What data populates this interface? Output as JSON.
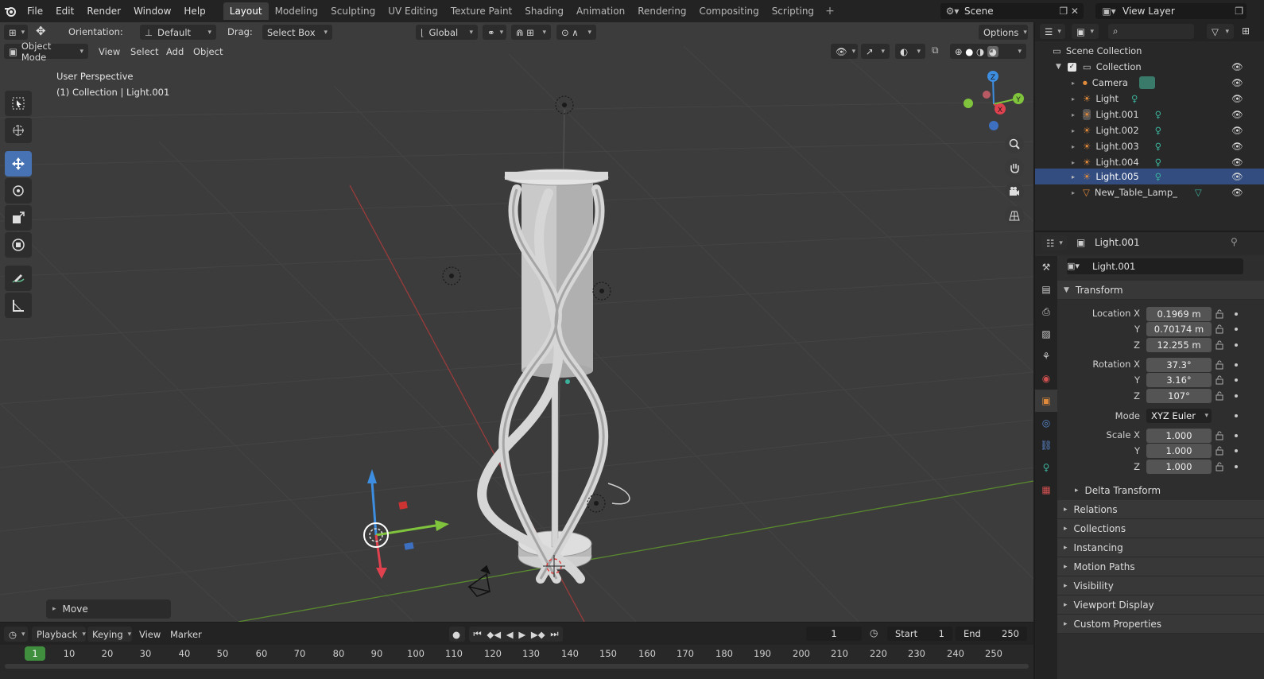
{
  "menu": {
    "items": [
      "File",
      "Edit",
      "Render",
      "Window",
      "Help"
    ]
  },
  "workspaces": {
    "tabs": [
      "Layout",
      "Modeling",
      "Sculpting",
      "UV Editing",
      "Texture Paint",
      "Shading",
      "Animation",
      "Rendering",
      "Compositing",
      "Scripting"
    ],
    "active": "Layout"
  },
  "scene": {
    "name": "Scene",
    "view_layer": "View Layer"
  },
  "viewport_header": {
    "orientation_label": "Orientation:",
    "orientation_value": "Default",
    "drag_label": "Drag:",
    "drag_value": "Select Box",
    "transform_orientation": "Global",
    "options_label": "Options",
    "mode": "Object Mode",
    "menus": [
      "View",
      "Select",
      "Add",
      "Object"
    ]
  },
  "viewport_info": {
    "perspective": "User Perspective",
    "context": "(1) Collection | Light.001"
  },
  "gizmo": {
    "x": "X",
    "y": "Y",
    "z": "Z"
  },
  "operator_panel": {
    "label": "Move"
  },
  "timeline": {
    "menus": [
      "Playback",
      "Keying",
      "View",
      "Marker"
    ],
    "current_frame": "1",
    "start_label": "Start",
    "start_value": "1",
    "end_label": "End",
    "end_value": "250",
    "ruler": [
      "1",
      "10",
      "20",
      "30",
      "40",
      "50",
      "60",
      "70",
      "80",
      "90",
      "100",
      "110",
      "120",
      "130",
      "140",
      "150",
      "160",
      "170",
      "180",
      "190",
      "200",
      "210",
      "220",
      "230",
      "240",
      "250"
    ]
  },
  "outliner": {
    "root": "Scene Collection",
    "collection": "Collection",
    "items": [
      {
        "name": "Camera",
        "type": "camera"
      },
      {
        "name": "Light",
        "type": "light"
      },
      {
        "name": "Light.001",
        "type": "light"
      },
      {
        "name": "Light.002",
        "type": "light"
      },
      {
        "name": "Light.003",
        "type": "light"
      },
      {
        "name": "Light.004",
        "type": "light"
      },
      {
        "name": "Light.005",
        "type": "light",
        "selected": true
      },
      {
        "name": "New_Table_Lamp_",
        "type": "mesh"
      }
    ]
  },
  "properties": {
    "header_object": "Light.001",
    "object_name": "Light.001",
    "transform": {
      "title": "Transform",
      "location_label": "Location X",
      "location": [
        "0.1969 m",
        "0.70174 m",
        "12.255 m"
      ],
      "rotation_label": "Rotation X",
      "rotation": [
        "37.3°",
        "3.16°",
        "107°"
      ],
      "mode_label": "Mode",
      "mode_value": "XYZ Euler",
      "scale_label": "Scale X",
      "scale": [
        "1.000",
        "1.000",
        "1.000"
      ],
      "axis_y": "Y",
      "axis_z": "Z"
    },
    "delta_transform": "Delta Transform",
    "panels": [
      "Relations",
      "Collections",
      "Instancing",
      "Motion Paths",
      "Visibility",
      "Viewport Display",
      "Custom Properties"
    ]
  },
  "colors": {
    "accent": "#4772b3",
    "selected_row": "#334d80",
    "frame_marker": "#3f8f3f",
    "axis_x": "#e0414e",
    "axis_y": "#7fc43c",
    "axis_z": "#3d8ee0",
    "light_icon": "#e08a3c",
    "data_icon": "#3cb09a"
  }
}
